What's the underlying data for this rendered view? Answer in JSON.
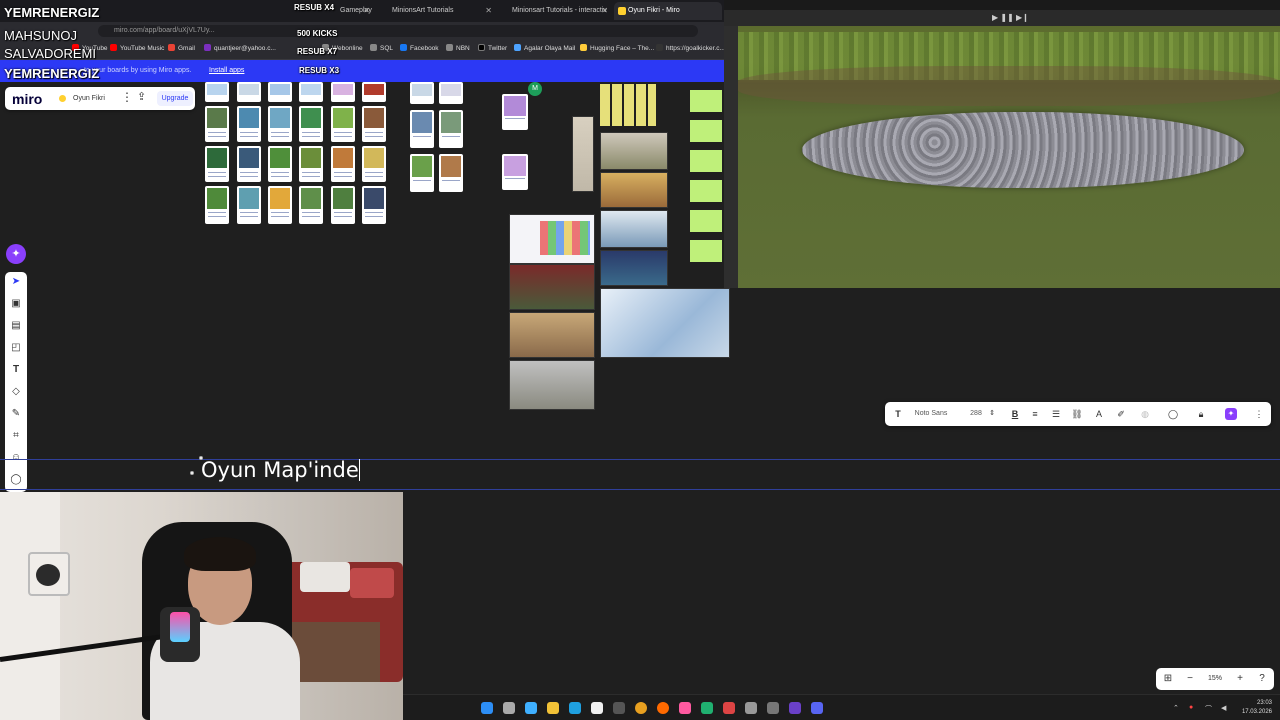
{
  "overlay": {
    "names": [
      "YEMRENERGIZ",
      "MAHSUNOJ",
      "SALVADOREMI",
      "YEMRENERGIZ"
    ],
    "right_labels": [
      "RESUB X4",
      "500 KICKS",
      "RESUB X7",
      "RESUB X3"
    ]
  },
  "browser": {
    "tabs": [
      {
        "label": "Gameplay",
        "active": false
      },
      {
        "label": "MinionsArt Tutorials",
        "active": false
      },
      {
        "label": "Minionsart Tutorials - interactiv",
        "active": false
      },
      {
        "label": "Oyun Fikri - Miro",
        "active": true
      }
    ],
    "address": "miro.com/app/board/uXjVL7Uy...",
    "bookmarks": [
      "YouTube",
      "YouTube Music",
      "Gmail",
      "quantjeer@yahoo.c...",
      "Webonline",
      "SQL",
      "Facebook",
      "NBN",
      "Twitter",
      "Agalar Olaya Mail",
      "Hugging Face – The...",
      "https://goalkicker.c..."
    ],
    "banner": {
      "message": "to your boards by using Miro apps.",
      "link": "Install apps"
    }
  },
  "miro": {
    "logo": "miro",
    "board_name": "Oyun Fikri",
    "upgrade": "Upgrade",
    "menu_icon": "more-vertical-icon",
    "share_icon": "share-icon"
  },
  "left_toolbar": {
    "tools": [
      "select-icon",
      "templates-icon",
      "frame-icon",
      "sticky-note-icon",
      "text-icon",
      "shapes-icon",
      "pen-icon",
      "frame-crop-icon",
      "emoji-icon",
      "comment-icon"
    ]
  },
  "text_toolbar": {
    "font": "Noto Sans",
    "size": "288"
  },
  "editing_text": "Oyun Map'inde",
  "zoom": {
    "value": "15%"
  },
  "clock": {
    "time": "23:03",
    "date": "17.03.2026"
  },
  "colors": {
    "miro_blue": "#2c39f5",
    "ai_purple": "#8a3ffc",
    "canvas": "#1f1f1f"
  }
}
